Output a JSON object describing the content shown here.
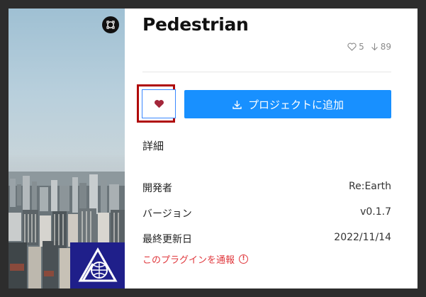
{
  "plugin": {
    "title": "Pedestrian",
    "likes": "5",
    "downloads": "89"
  },
  "actions": {
    "add_to_project_label": "プロジェクトに追加"
  },
  "details": {
    "heading": "詳細",
    "rows": [
      {
        "label": "開発者",
        "value": "Re:Earth"
      },
      {
        "label": "バージョン",
        "value": "v0.1.7"
      },
      {
        "label": "最終更新日",
        "value": "2022/11/14"
      }
    ]
  },
  "report": {
    "label": "このプラグインを通報",
    "icon_glyph": "!"
  },
  "colors": {
    "primary": "#1890ff",
    "like_heart": "#a3263a",
    "highlight": "#b00a0a",
    "report": "#e0383d"
  }
}
